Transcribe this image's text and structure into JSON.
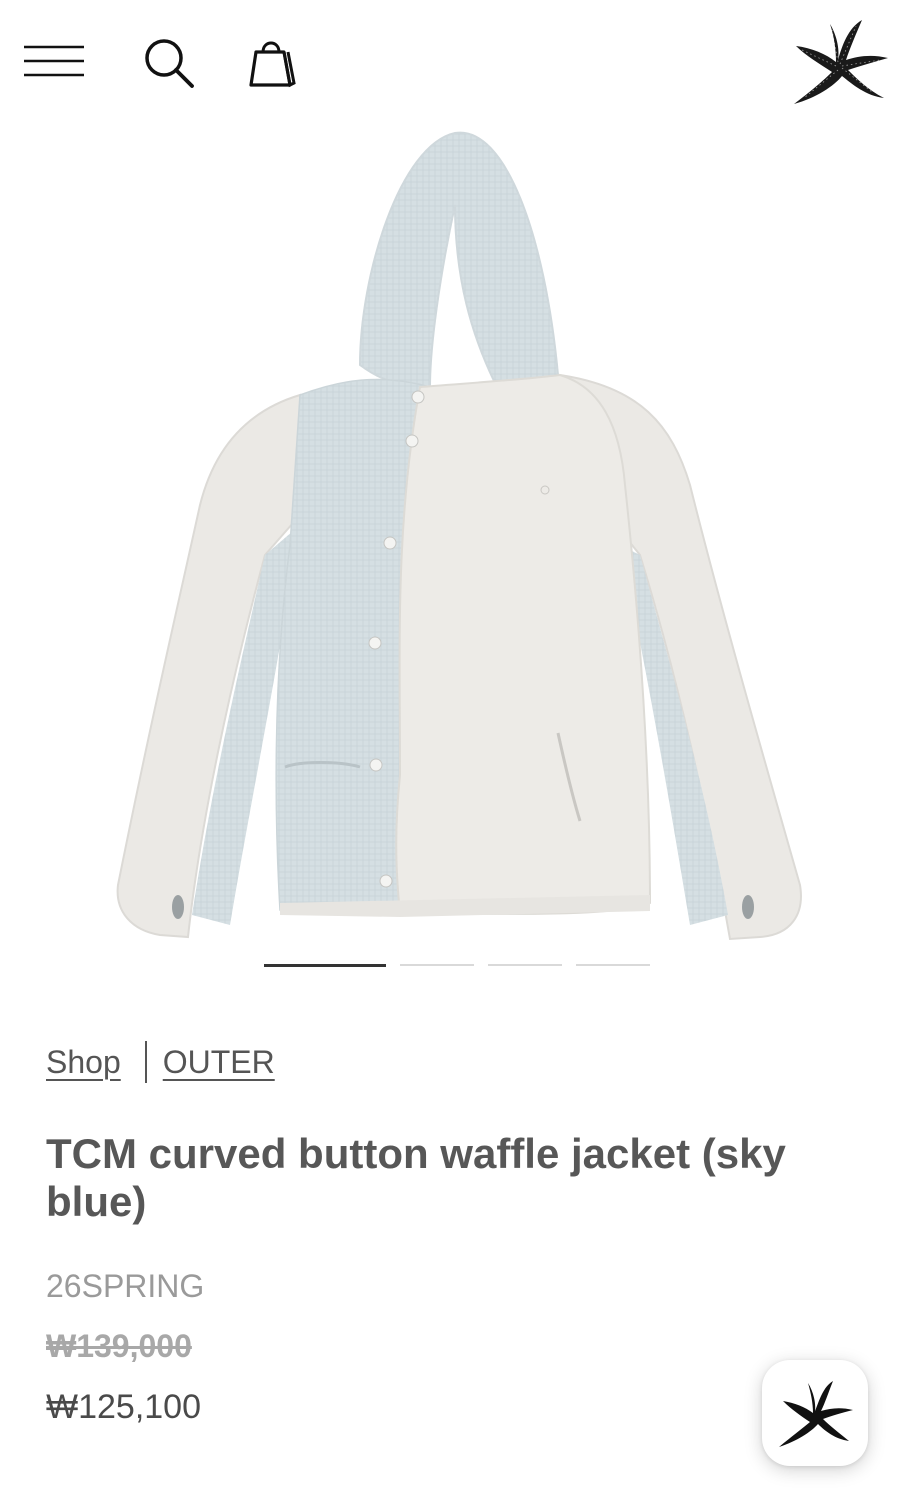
{
  "header": {
    "menu_icon": "hamburger-menu-icon",
    "search_icon": "search-icon",
    "bag_icon": "shopping-bag-icon",
    "logo_icon": "starfish-logo-icon"
  },
  "gallery": {
    "image_subject": "jacket-photo",
    "page_count": 4,
    "active_index": 0
  },
  "breadcrumb": {
    "shop_label": "Shop",
    "category_label": "OUTER"
  },
  "product": {
    "title": "TCM curved button waffle jacket (sky blue)",
    "season": "26SPRING",
    "original_price": "₩139,000",
    "sale_price": "₩125,100"
  },
  "fab": {
    "icon": "starfish-chat-icon"
  },
  "colors": {
    "text": "#555555",
    "muted": "#9a9a9a",
    "jacket_main": "#eceae6",
    "jacket_blue": "#d5dfe3"
  }
}
